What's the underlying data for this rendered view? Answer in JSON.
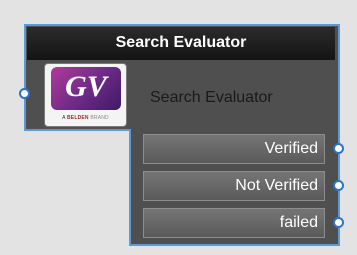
{
  "node": {
    "title": "Search Evaluator",
    "label": "Search Evaluator",
    "logo": {
      "icon": "gv-logo-icon",
      "mark": "GV",
      "tagline_prefix": "A",
      "tagline_brand": "BELDEN",
      "tagline_suffix": "BRAND"
    },
    "outputs": [
      {
        "label": "Verified"
      },
      {
        "label": "Not Verified"
      },
      {
        "label": "failed"
      }
    ]
  },
  "colors": {
    "canvas": "#e3e3e3",
    "node_body": "#4f4f4f",
    "header": "#1d1d1d",
    "outline": "#5b9bd5",
    "port_ring": "#2b73c5",
    "output_button": "#6a6a6a"
  }
}
